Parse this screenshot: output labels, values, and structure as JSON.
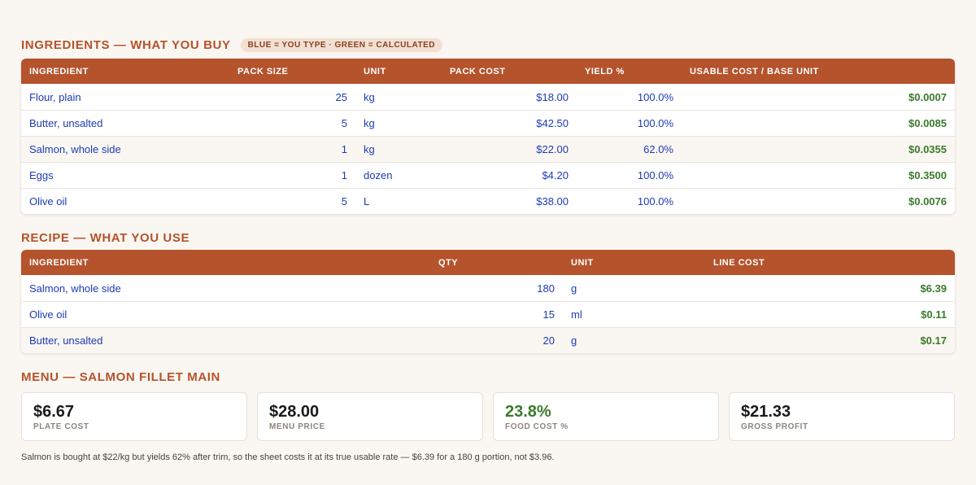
{
  "ingredients": {
    "title": "INGREDIENTS — WHAT YOU BUY",
    "badge": "BLUE = YOU TYPE · GREEN = CALCULATED",
    "headers": [
      "INGREDIENT",
      "PACK SIZE",
      "UNIT",
      "PACK COST",
      "YIELD %",
      "USABLE COST / BASE UNIT"
    ],
    "rows": [
      {
        "name": "Flour, plain",
        "pack_size": "25",
        "unit": "kg",
        "pack_cost": "$18.00",
        "yield": "100.0%",
        "usable_cost": "$0.0007"
      },
      {
        "name": "Butter, unsalted",
        "pack_size": "5",
        "unit": "kg",
        "pack_cost": "$42.50",
        "yield": "100.0%",
        "usable_cost": "$0.0085"
      },
      {
        "name": "Salmon, whole side",
        "pack_size": "1",
        "unit": "kg",
        "pack_cost": "$22.00",
        "yield": "62.0%",
        "usable_cost": "$0.0355"
      },
      {
        "name": "Eggs",
        "pack_size": "1",
        "unit": "dozen",
        "pack_cost": "$4.20",
        "yield": "100.0%",
        "usable_cost": "$0.3500"
      },
      {
        "name": "Olive oil",
        "pack_size": "5",
        "unit": "L",
        "pack_cost": "$38.00",
        "yield": "100.0%",
        "usable_cost": "$0.0076"
      }
    ]
  },
  "recipe": {
    "title": "RECIPE — WHAT YOU USE",
    "headers": [
      "INGREDIENT",
      "QTY",
      "UNIT",
      "LINE COST"
    ],
    "rows": [
      {
        "name": "Salmon, whole side",
        "qty": "180",
        "unit": "g",
        "line_cost": "$6.39"
      },
      {
        "name": "Olive oil",
        "qty": "15",
        "unit": "ml",
        "line_cost": "$0.11"
      },
      {
        "name": "Butter, unsalted",
        "qty": "20",
        "unit": "g",
        "line_cost": "$0.17"
      }
    ]
  },
  "menu": {
    "title": "MENU — SALMON FILLET MAIN",
    "cards": [
      {
        "value": "$6.67",
        "label": "PLATE COST"
      },
      {
        "value": "$28.00",
        "label": "MENU PRICE"
      },
      {
        "value": "23.8%",
        "label": "FOOD COST %"
      },
      {
        "value": "$21.33",
        "label": "GROSS PROFIT"
      }
    ],
    "note": "Salmon is bought at $22/kg but yields 62% after trim, so the sheet costs it at its true usable rate — $6.39 for a 180 g portion, not $3.96."
  },
  "colors": {
    "accent": "#b4532c",
    "input_blue": "#1c3bb5",
    "calc_green": "#3b7a2a",
    "background": "#faf6f1"
  }
}
